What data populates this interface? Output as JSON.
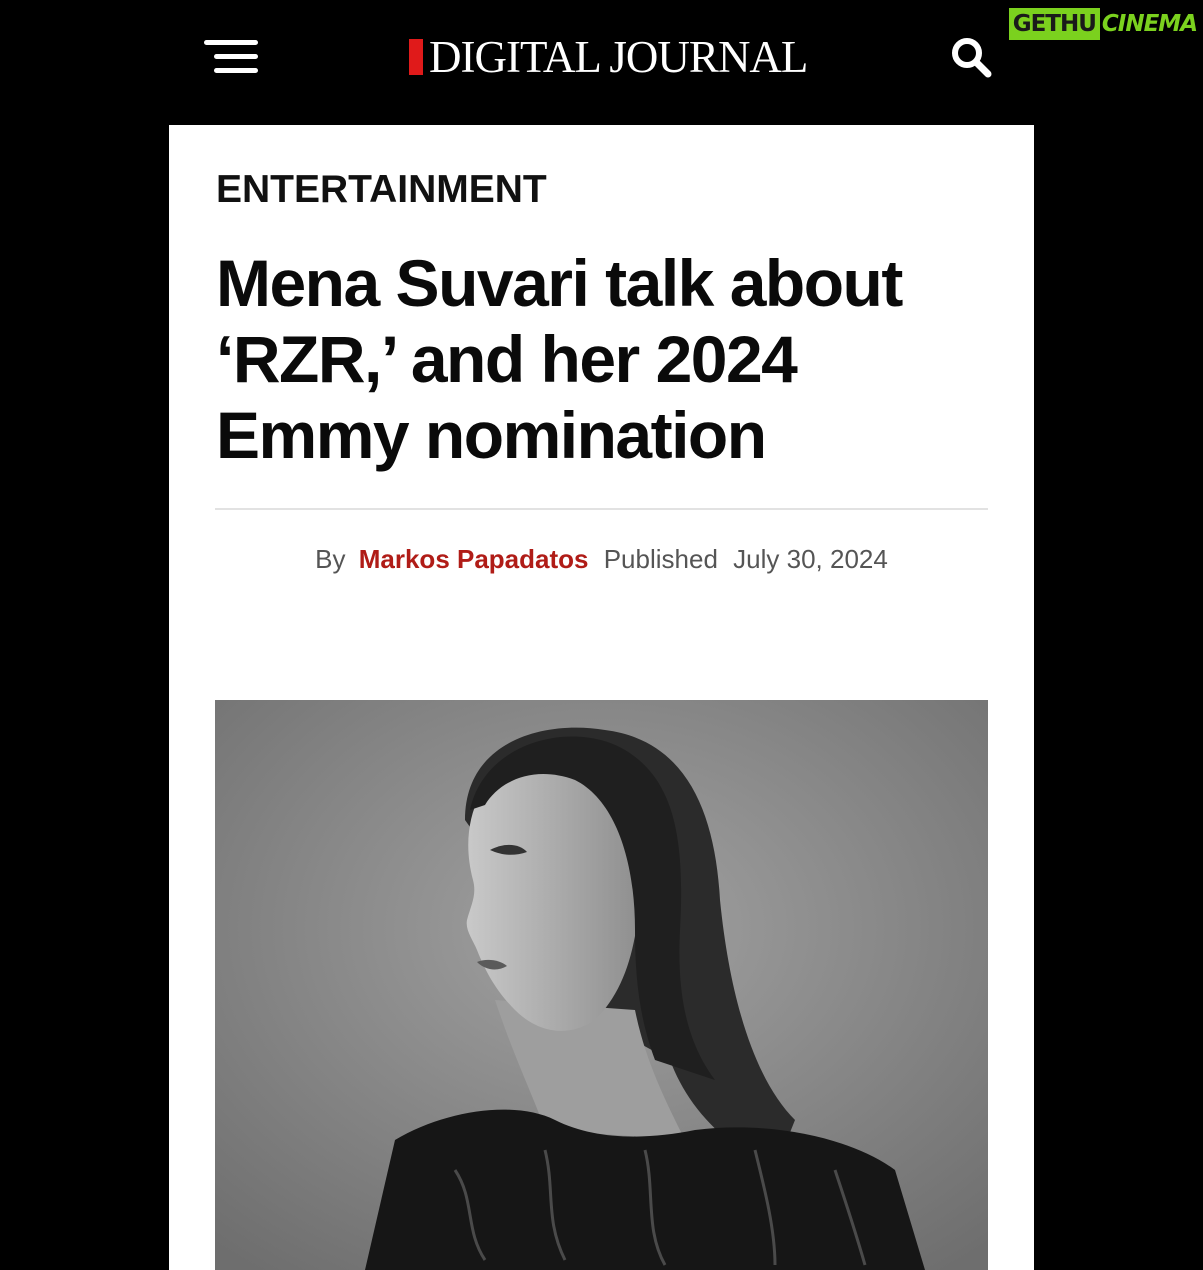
{
  "header": {
    "logo_text": "DIGITAL JOURNAL",
    "menu_icon": "hamburger-menu-icon",
    "search_icon": "search-icon",
    "accent_color": "#e01a1a"
  },
  "watermark": {
    "part1": "GETHU",
    "part2": "CINEMA",
    "color": "#7bd11e"
  },
  "article": {
    "category": "ENTERTAINMENT",
    "headline": "Mena Suvari talk about ‘RZR,’ and her 2024 Emmy nomination",
    "byline": {
      "by_label": "By",
      "author": "Markos Papadatos",
      "published_label": "Published",
      "date": "July 30, 2024",
      "author_color": "#b01c17"
    },
    "image": {
      "kind": "black-and-white portrait photo"
    }
  }
}
